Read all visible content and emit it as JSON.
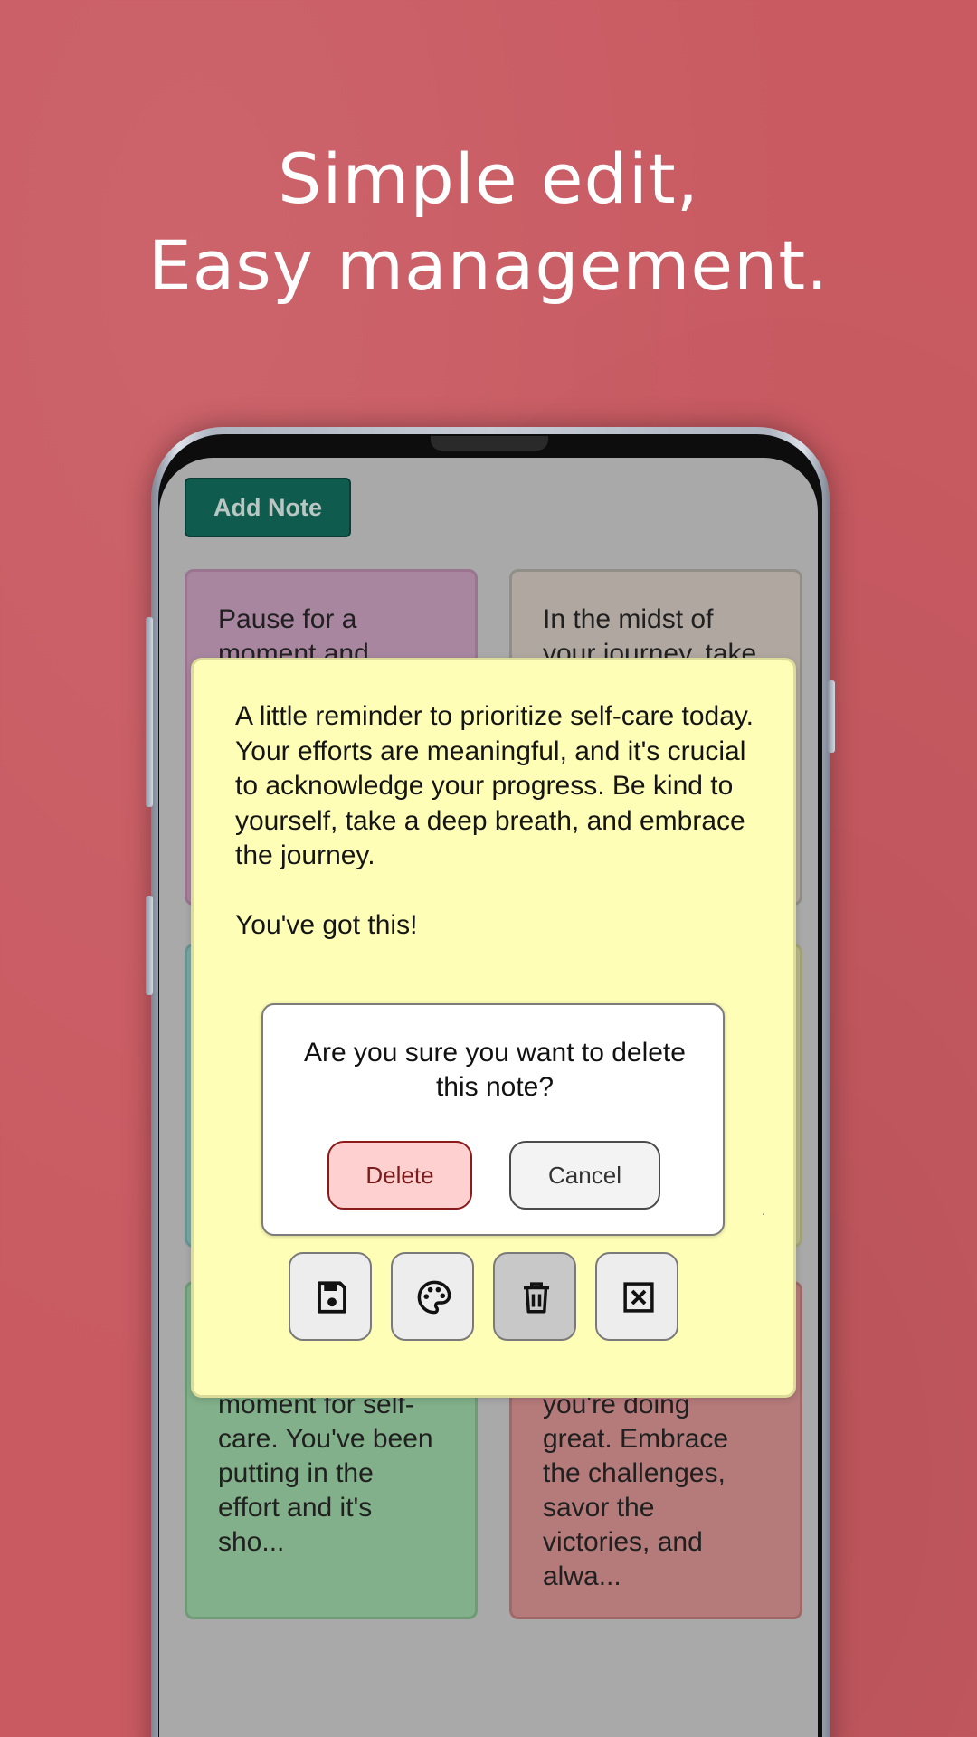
{
  "headline": {
    "line1": "Simple edit,",
    "line2": "Easy management."
  },
  "toolbar": {
    "add_note_label": "Add Note"
  },
  "notes": [
    {
      "text": "Pause for a\nmoment and",
      "color": "#a8869f"
    },
    {
      "text": "In the midst of\nyour journey, take",
      "color": "#b0a8a0"
    },
    {
      "text": "moment for self-\ncare. You've been\nputting in the\neffort and it's\nsho...",
      "color": "#82b08a"
    },
    {
      "text": "you're doing\ngreat. Embrace\nthe challenges,\nsavor the\nvictories, and\nalwa...",
      "color": "#b57a7a"
    }
  ],
  "editor": {
    "text": "A little reminder to prioritize self-care today. Your efforts are meaningful, and it's crucial to acknowledge your progress. Be kind to yourself, take a deep breath, and embrace the journey.\n\nYou've got this!",
    "background": "#fefeb6"
  },
  "confirm_dialog": {
    "message": "Are you sure you want to delete this note?",
    "delete_label": "Delete",
    "cancel_label": "Cancel"
  },
  "editor_actions": [
    {
      "icon": "save-icon"
    },
    {
      "icon": "palette-icon"
    },
    {
      "icon": "trash-icon"
    },
    {
      "icon": "close-icon"
    }
  ],
  "colors": {
    "background": "#c95a62",
    "add_note_button": "#0f5b4e",
    "delete_button_bg": "#ffd0d0",
    "delete_button_border": "#8b1a1a"
  }
}
